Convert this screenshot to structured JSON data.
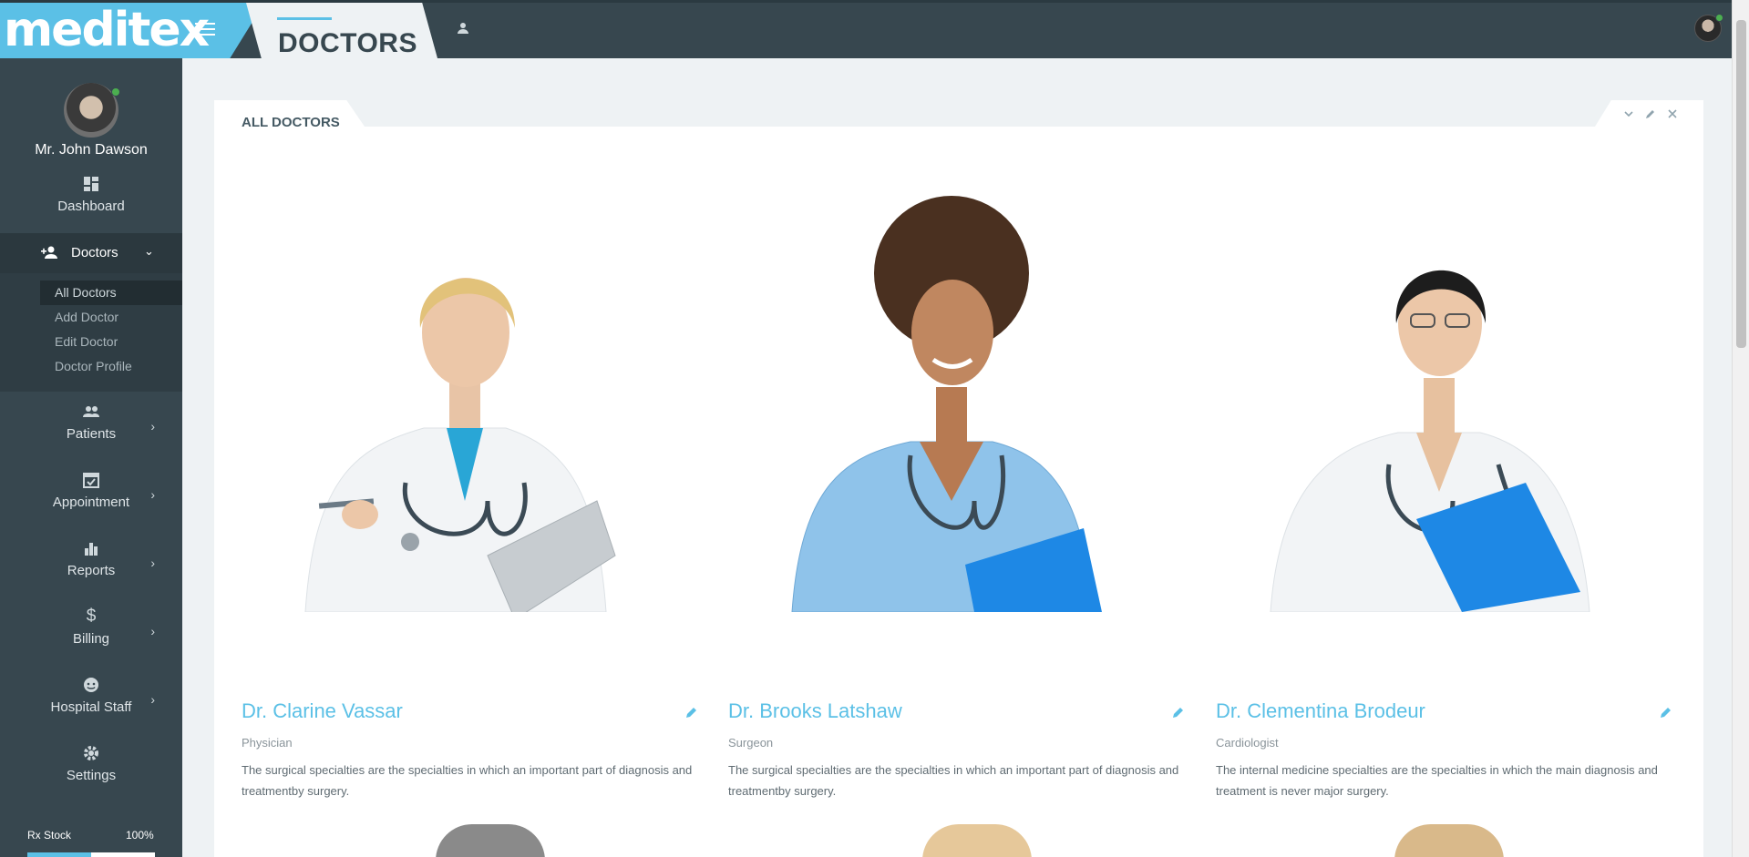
{
  "header": {
    "brand": "meditex",
    "page_title": "DOCTORS"
  },
  "profile": {
    "name": "Mr. John Dawson"
  },
  "sidebar": {
    "dashboard": "Dashboard",
    "doctors": "Doctors",
    "doctors_sub": [
      "All Doctors",
      "Add Doctor",
      "Edit Doctor",
      "Doctor Profile"
    ],
    "patients": "Patients",
    "appointment": "Appointment",
    "reports": "Reports",
    "billing": "Billing",
    "hospital_staff": "Hospital Staff",
    "settings": "Settings",
    "rx_stock_label": "Rx Stock",
    "rx_stock_value": "100%",
    "rx_stock_fraction": 1.0
  },
  "panel": {
    "title": "ALL DOCTORS"
  },
  "doctors": [
    {
      "name": "Dr. Clarine Vassar",
      "specialty": "Physician",
      "description": "The surgical specialties are the specialties in which an important part of diagnosis and treatmentby surgery."
    },
    {
      "name": "Dr. Brooks Latshaw",
      "specialty": "Surgeon",
      "description": "The surgical specialties are the specialties in which an important part of diagnosis and treatmentby surgery."
    },
    {
      "name": "Dr. Clementina Brodeur",
      "specialty": "Cardiologist",
      "description": "The internal medicine specialties are the specialties in which the main diagnosis and treatment is never major surgery."
    }
  ],
  "colors": {
    "accent": "#5bc0e6",
    "sidebar": "#37474f",
    "online": "#4caf50"
  }
}
